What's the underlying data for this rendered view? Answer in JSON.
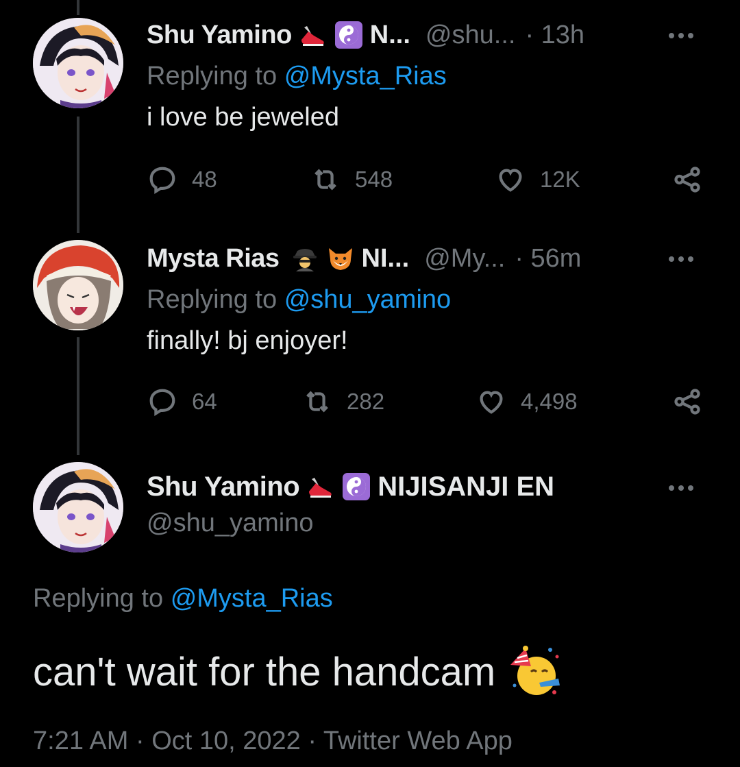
{
  "tweets": [
    {
      "display_name": "Shu Yamino",
      "org_short": "N...",
      "handle": "@shu...",
      "time": "· 13h",
      "replying_prefix": "Replying to",
      "replying_to": "@Mysta_Rias",
      "text": "i love be jeweled",
      "replies": "48",
      "retweets": "548",
      "likes": "12K",
      "badges": [
        "shoe-icon",
        "yin-yang-icon"
      ]
    },
    {
      "display_name": "Mysta Rias",
      "org_short": "NI...",
      "handle": "@My...",
      "time": "· 56m",
      "replying_prefix": "Replying to",
      "replying_to": "@shu_yamino",
      "text": "finally! bj enjoyer!",
      "replies": "64",
      "retweets": "282",
      "likes": "4,498",
      "badges": [
        "detective-icon",
        "fox-icon"
      ]
    }
  ],
  "main_tweet": {
    "display_name": "Shu Yamino",
    "org": "NIJISANJI EN",
    "handle": "@shu_yamino",
    "replying_prefix": "Replying to",
    "replying_to": "@Mysta_Rias",
    "text": "can't wait for the handcam",
    "emoji": "partying-face-icon",
    "meta": "7:21 AM · Oct 10, 2022 · Twitter Web App",
    "badges": [
      "shoe-icon",
      "yin-yang-icon"
    ]
  },
  "colors": {
    "background": "#000000",
    "text": "#e7e9ea",
    "secondary": "#71767b",
    "link": "#1d9bf0",
    "thread_line": "#333639"
  }
}
